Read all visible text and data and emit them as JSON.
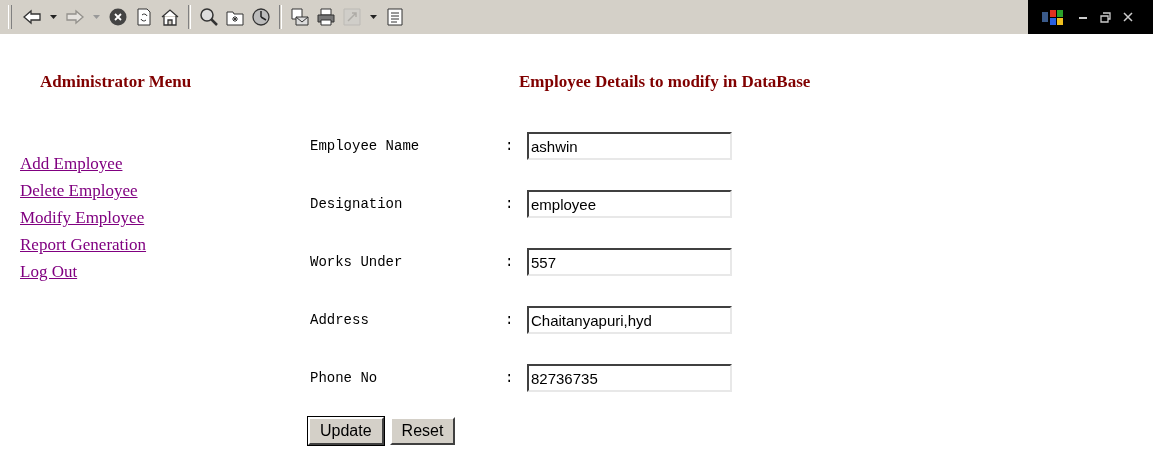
{
  "toolbar": {
    "items": [
      {
        "kind": "back",
        "disabled": false
      },
      {
        "kind": "dropdown",
        "disabled": false
      },
      {
        "kind": "forward",
        "disabled": true
      },
      {
        "kind": "dropdown",
        "disabled": true
      },
      {
        "kind": "stop",
        "disabled": false
      },
      {
        "kind": "refresh",
        "disabled": false
      },
      {
        "kind": "home",
        "disabled": false
      },
      {
        "kind": "separator"
      },
      {
        "kind": "search",
        "disabled": false
      },
      {
        "kind": "favorites",
        "disabled": false
      },
      {
        "kind": "history",
        "disabled": false
      },
      {
        "kind": "separator"
      },
      {
        "kind": "mail",
        "disabled": false
      },
      {
        "kind": "print",
        "disabled": false
      },
      {
        "kind": "edit",
        "disabled": true
      },
      {
        "kind": "dropdown",
        "disabled": false
      },
      {
        "kind": "document",
        "disabled": false
      }
    ]
  },
  "sidebar": {
    "title": "Administrator Menu",
    "links": [
      "Add Employee",
      "Delete Employee",
      "Modify Employee",
      "Report Generation",
      "Log Out"
    ]
  },
  "form": {
    "title": "Employee Details to modify in DataBase",
    "fields": [
      {
        "label": "Employee Name",
        "separator": ":",
        "value": "ashwin"
      },
      {
        "label": "Designation",
        "separator": ":",
        "value": "employee"
      },
      {
        "label": "Works Under",
        "separator": ":",
        "value": "557"
      },
      {
        "label": "Address",
        "separator": ":",
        "value": "Chaitanyapuri,hyd"
      },
      {
        "label": "Phone No",
        "separator": ":",
        "value": "82736735"
      }
    ],
    "buttons": [
      {
        "label": "Update",
        "default": true
      },
      {
        "label": "Reset",
        "default": false
      }
    ]
  }
}
